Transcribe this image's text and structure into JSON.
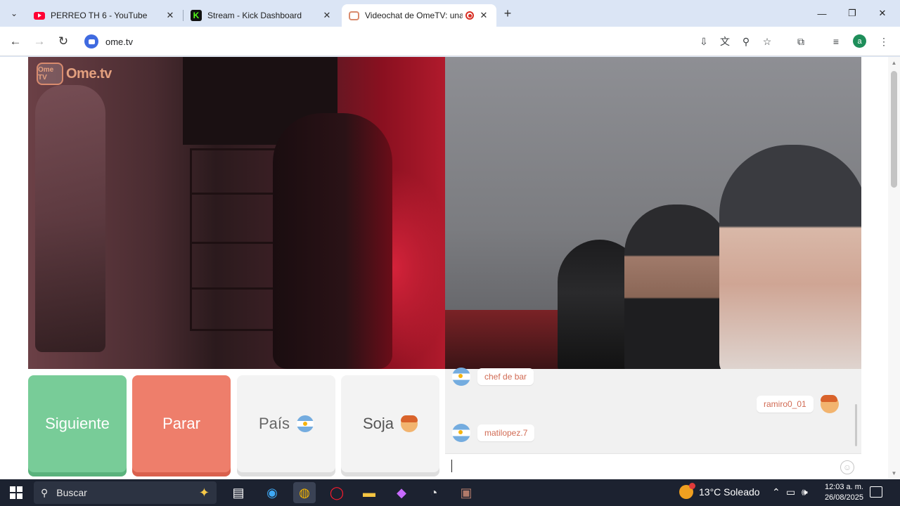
{
  "browser": {
    "tabs": [
      {
        "title": "PERREO TH 6 - YouTube",
        "icon": "youtube-icon"
      },
      {
        "title": "Stream - Kick Dashboard",
        "icon": "kick-icon"
      },
      {
        "title": "Videochat de OmeTV: una a",
        "icon": "ometv-icon",
        "active": true
      }
    ],
    "url": "ome.tv"
  },
  "page": {
    "logo_badge": "Ome TV",
    "logo_text": "Ome.tv",
    "buttons": {
      "next": "Siguiente",
      "stop": "Parar",
      "country": "País",
      "gender": "Soja"
    },
    "chat": {
      "messages": [
        {
          "user": "chef de bar",
          "side": "left"
        },
        {
          "user": "ramiro0_01",
          "side": "right"
        },
        {
          "user": "matilopez.7",
          "side": "left"
        }
      ],
      "input_value": ""
    }
  },
  "taskbar": {
    "search_placeholder": "Buscar",
    "weather": "13°C  Soleado",
    "time": "12:03 a. m.",
    "date": "26/08/2025"
  },
  "colors": {
    "next": "#78cc98",
    "stop": "#ee7e6b",
    "chat_name": "#d16b54"
  }
}
